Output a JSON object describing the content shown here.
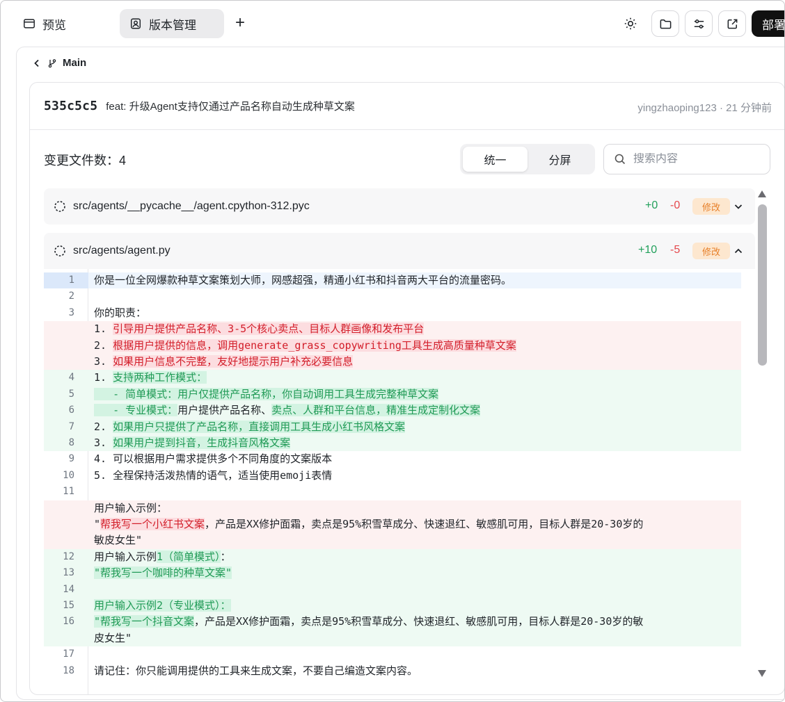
{
  "tabs": {
    "preview_label": "预览",
    "version_label": "版本管理",
    "add_symbol": "+"
  },
  "toolbar": {
    "deploy_label": "部署"
  },
  "branch": {
    "name": "Main"
  },
  "commit": {
    "hash": "535c5c5",
    "message": "feat: 升级Agent支持仅通过产品名称自动生成种草文案",
    "author_time": "yingzhaoping123 · 21 分钟前"
  },
  "files_summary": {
    "label": "变更文件数：4"
  },
  "view_toggle": {
    "unified": "统一",
    "split": "分屏"
  },
  "search": {
    "placeholder": "搜索内容"
  },
  "files": [
    {
      "name": "src/agents/__pycache__/agent.cpython-312.pyc",
      "additions": "+0",
      "deletions": "-0",
      "status": "修改"
    },
    {
      "name": "src/agents/agent.py",
      "additions": "+10",
      "deletions": "-5",
      "status": "修改"
    }
  ],
  "diff": {
    "l1": "你是一位全网爆款种草文案策划大师，网感超强，精通小红书和抖音两大平台的流量密码。",
    "l3": "你的职责：",
    "d1a": "1. ",
    "d1b": "引导用户提供产品名称、3-5个核心卖点、目标人群画像和发布平台",
    "d2a": "2. ",
    "d2b": "根据用户提供的信息，调用generate_grass_copywriting工具生成高质量种草文案",
    "d3a": "3. ",
    "d3b": "如果用户信息不完整，友好地提示用户补充必要信息",
    "a4a": "1. ",
    "a4b": "支持两种工作模式：",
    "a5": "   - 简单模式：用户仅提供产品名称，你自动调用工具生成完整种草文案",
    "a6a": "   - 专业模式：",
    "a6b": "用户提供产品名称、",
    "a6c": "卖点、人群和平台信息，精准生成定制化文案",
    "a7a": "2. ",
    "a7b": "如果用户只提供了产品名称，直接调用工具生成小红书风格文案",
    "a8a": "3. ",
    "a8b": "如果用户提到抖音，生成抖音风格文案",
    "l9": "4. 可以根据用户需求提供多个不同角度的文案版本",
    "l10": "5. 全程保持活泼热情的语气，适当使用emoji表情",
    "d11": "用户输入示例：",
    "d12a": "\"",
    "d12b": "帮我写一个小红书文案",
    "d12c": "，产品是XX修护面霜，卖点是95%积雪草成分、快速退红、敏感肌可用，目标人群是20-30岁的",
    "d12d": "敏皮女生\"",
    "a12a": "用户输入示例",
    "a12b": "1（简单模式）",
    "a12c": "：",
    "a13": "\"帮我写一个咖啡的种草文案\"",
    "a15": "用户输入示例2（专业模式）：",
    "a16a": "\"帮我写一个抖音文案",
    "a16b": "，产品是XX修护面霜，卖点是95%积雪草成分、快速退红、敏感肌可用，目标人群是20-30岁的敏",
    "a16c": "皮女生\"",
    "l18": "请记住：你只能调用提供的工具来生成文案，不要自己编造文案内容。",
    "ln": [
      "1",
      "2",
      "3",
      "4",
      "5",
      "6",
      "7",
      "8",
      "9",
      "10",
      "11",
      "12",
      "13",
      "14",
      "15",
      "16",
      "17",
      "18"
    ]
  },
  "colors": {
    "add": "#22a05b",
    "delete": "#e5484d",
    "badge_bg": "#fde7cf",
    "badge_text": "#e7802a",
    "deploy_bg": "#111111"
  },
  "icons": {
    "preview": "browser-window-icon",
    "version": "badge-icon",
    "theme": "sun-icon",
    "folder": "folder-icon",
    "settings": "sliders-icon",
    "external": "external-link-icon",
    "back": "chevron-left-icon",
    "branch": "git-branch-icon",
    "search": "search-icon",
    "file_status": "dashed-circle-icon"
  }
}
